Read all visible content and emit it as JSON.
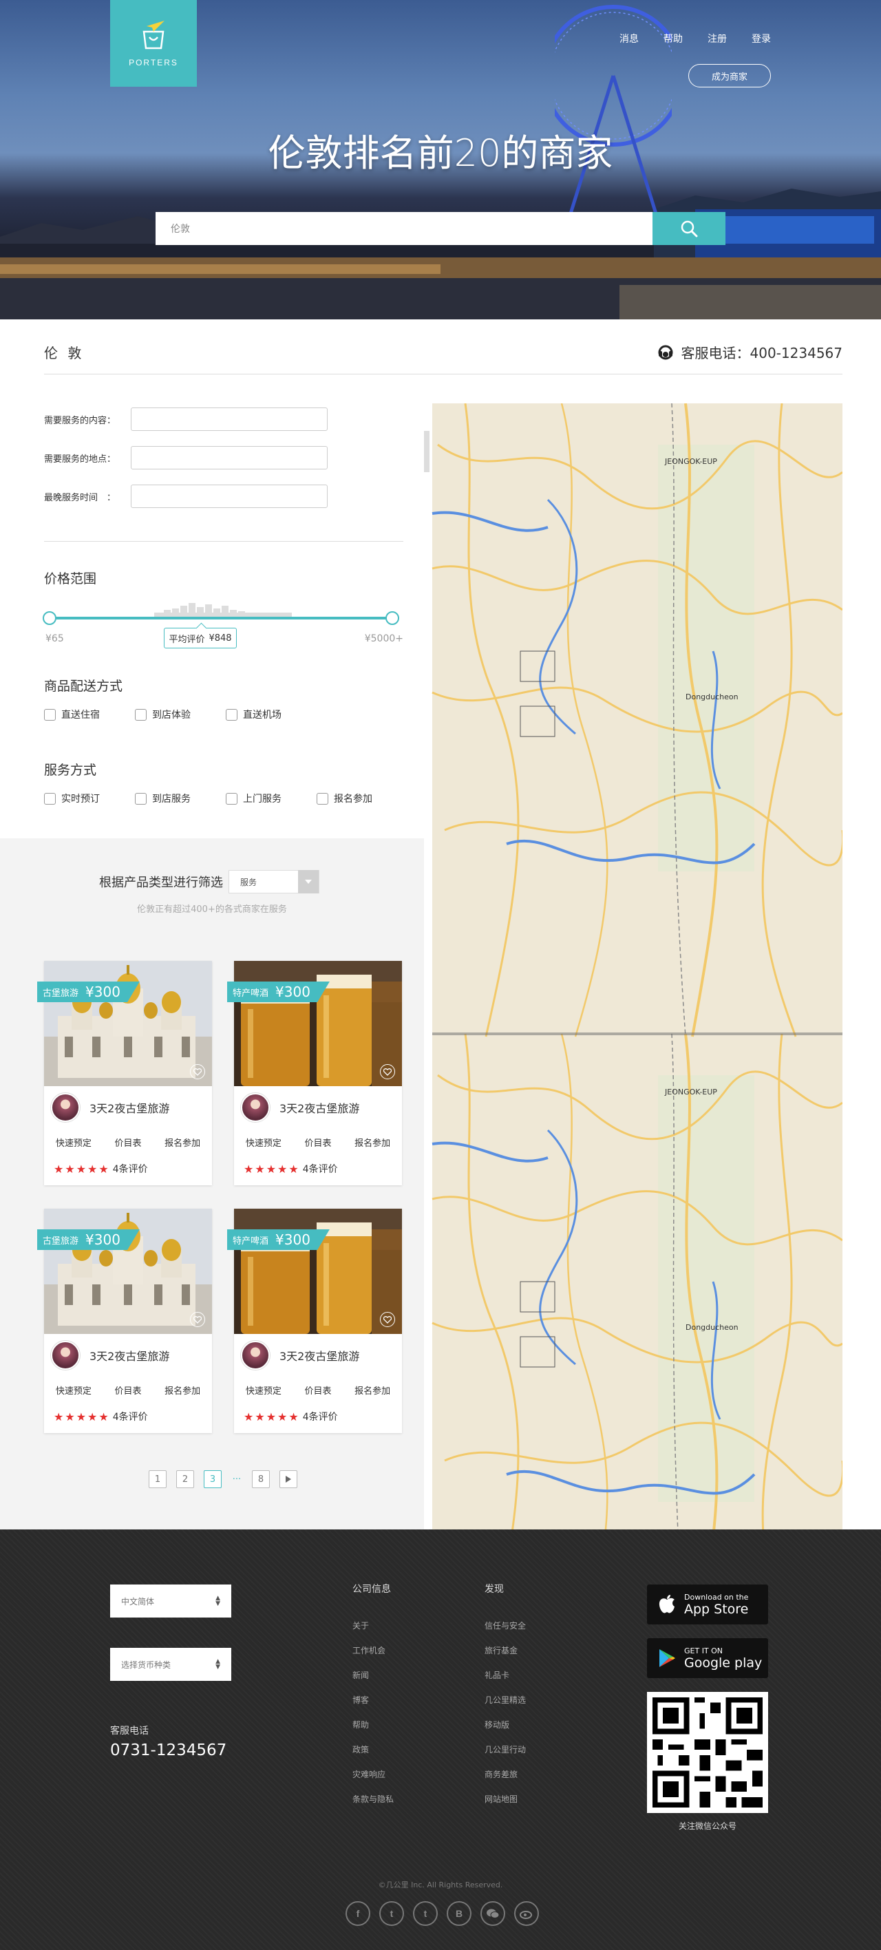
{
  "brand": {
    "name": "PORTERS",
    "accent": "#46bcc1"
  },
  "nav": {
    "items": [
      "消息",
      "帮助",
      "注册",
      "登录"
    ],
    "merchant_button": "成为商家"
  },
  "hero": {
    "title": "伦敦排名前20的商家",
    "search_value": "伦敦"
  },
  "section": {
    "city": "伦 敦",
    "phone_label": "客服电话：400-1234567"
  },
  "filters": {
    "service_content_label": "需要服务的内容：",
    "service_location_label": "需要服务的地点：",
    "latest_time_label": "最晚服务时间　：",
    "price_title": "价格范围",
    "price_min": "¥65",
    "price_max": "¥5000+",
    "avg_label": "平均评价",
    "avg_value": "¥848",
    "delivery_title": "商品配送方式",
    "delivery_options": [
      "直送住宿",
      "到店体验",
      "直送机场"
    ],
    "service_title": "服务方式",
    "service_options": [
      "实时预订",
      "到店服务",
      "上门服务",
      "报名参加"
    ]
  },
  "listing": {
    "sort_label": "根据产品类型进行筛选",
    "sort_value": "服务",
    "sub_text": "伦敦正有超过400+的各式商家在服务",
    "cards": [
      {
        "tag": "古堡旅游",
        "price": "¥300",
        "title": "3天2夜古堡旅游",
        "actions": [
          "快速预定",
          "价目表",
          "报名参加"
        ],
        "rating": "4条评价",
        "photo": "cathedral"
      },
      {
        "tag": "特产啤酒",
        "price": "¥300",
        "title": "3天2夜古堡旅游",
        "actions": [
          "快速预定",
          "价目表",
          "报名参加"
        ],
        "rating": "4条评价",
        "photo": "beer"
      },
      {
        "tag": "古堡旅游",
        "price": "¥300",
        "title": "3天2夜古堡旅游",
        "actions": [
          "快速预定",
          "价目表",
          "报名参加"
        ],
        "rating": "4条评价",
        "photo": "cathedral"
      },
      {
        "tag": "特产啤酒",
        "price": "¥300",
        "title": "3天2夜古堡旅游",
        "actions": [
          "快速预定",
          "价目表",
          "报名参加"
        ],
        "rating": "4条评价",
        "photo": "beer"
      }
    ],
    "stars": "★★★★★",
    "pagination": [
      "1",
      "2",
      "3",
      "···",
      "8"
    ],
    "current_page": "3"
  },
  "map": {
    "labels": [
      "JEONGOK-EUP",
      "Dongducheon",
      "JEONGOK-EUP",
      "Dongducheon"
    ]
  },
  "footer": {
    "language": "中文简体",
    "currency": "选择货币种类",
    "cs_label": "客服电话",
    "cs_phone": "0731-1234567",
    "col1_title": "公司信息",
    "col1_links": [
      "关于",
      "工作机会",
      "新闻",
      "博客",
      "帮助",
      "政策",
      "灾难响应",
      "条款与隐私"
    ],
    "col2_title": "发现",
    "col2_links": [
      "信任与安全",
      "旅行基金",
      "礼品卡",
      "几公里精选",
      "移动版",
      "几公里行动",
      "商务差旅",
      "网站地图"
    ],
    "appstore_small": "Download on the",
    "appstore_big": "App Store",
    "gplay_small": "GET IT ON",
    "gplay_big": "Google play",
    "qr_label": "关注微信公众号",
    "copyright": "©几公里 Inc. All Rights Reserved.",
    "social_icons": [
      "facebook-icon",
      "twitter-icon",
      "tumblr-icon",
      "blogger-icon",
      "wechat-icon",
      "weibo-icon"
    ]
  }
}
